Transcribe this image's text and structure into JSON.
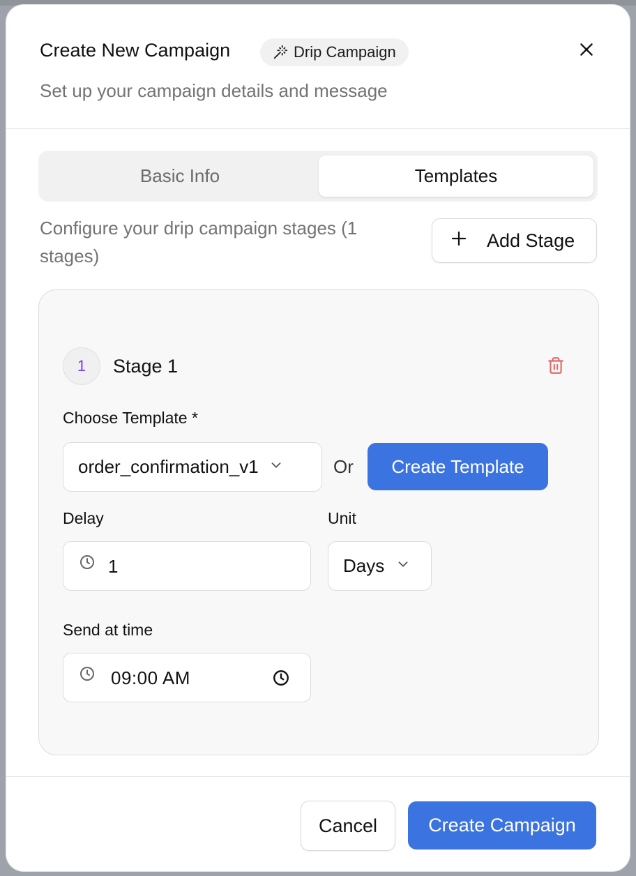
{
  "dialog": {
    "title": "Create New Campaign",
    "type_badge": "Drip Campaign",
    "subtitle": "Set up your campaign details and message",
    "close_icon": "close-icon"
  },
  "tabs": [
    {
      "label": "Basic Info",
      "active": false
    },
    {
      "label": "Templates",
      "active": true
    }
  ],
  "stages_section": {
    "description": "Configure your drip campaign stages (1 stages)",
    "add_stage_label": "Add Stage",
    "add_icon": "plus-icon"
  },
  "stage": {
    "number": "1",
    "title": "Stage 1",
    "delete_icon": "trash-icon",
    "template_label": "Choose Template *",
    "template_value": "order_confirmation_v1",
    "or_text": "Or",
    "create_template_label": "Create Template",
    "delay_label": "Delay",
    "delay_value": "1",
    "unit_label": "Unit",
    "unit_value": "Days",
    "send_time_label": "Send at time",
    "send_time_value": "09:00 AM"
  },
  "footer": {
    "cancel_label": "Cancel",
    "create_label": "Create Campaign"
  },
  "colors": {
    "primary": "#3b73e0",
    "stage_number": "#7c3aed",
    "delete": "#e06a6a",
    "muted_text": "#737373"
  }
}
